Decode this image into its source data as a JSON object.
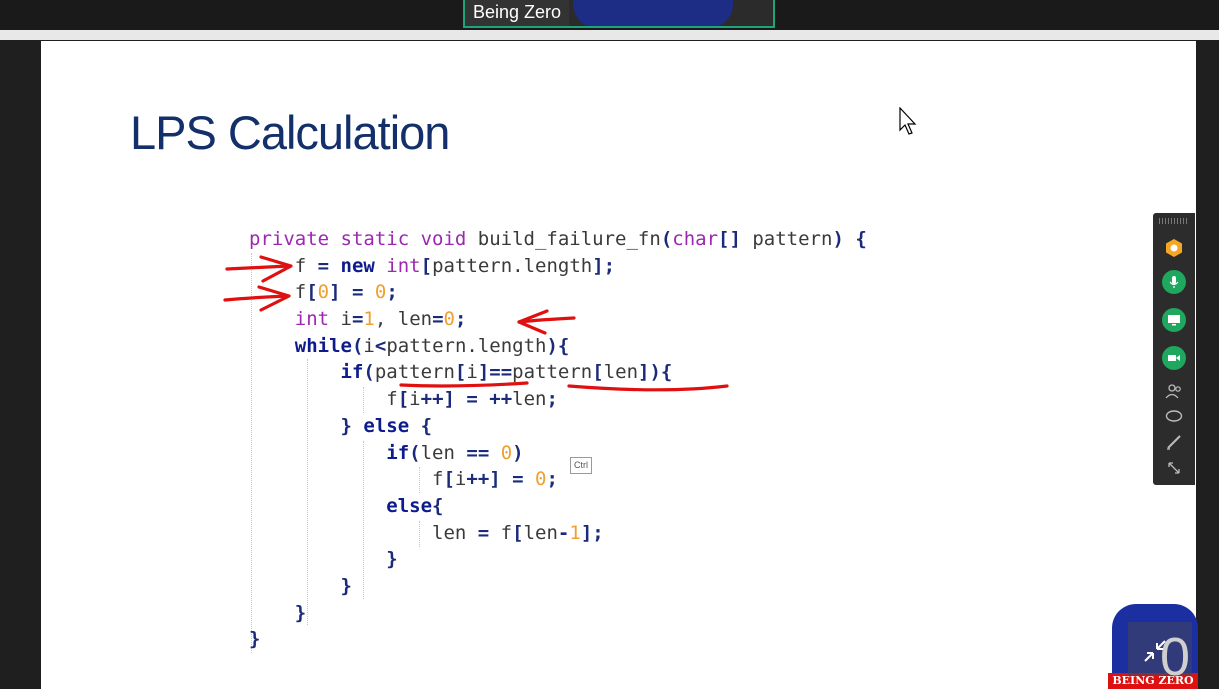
{
  "participant": {
    "name": "Being Zero"
  },
  "slide": {
    "title": "LPS Calculation"
  },
  "code_lines": [
    [
      {
        "t": "private static void",
        "c": "kw"
      },
      {
        "t": " build_failure_fn",
        "c": ""
      },
      {
        "t": "(",
        "c": "op"
      },
      {
        "t": "char",
        "c": "kw"
      },
      {
        "t": "[]",
        "c": "op"
      },
      {
        "t": " pattern",
        "c": ""
      },
      {
        "t": ")",
        "c": "op"
      },
      {
        "t": " {",
        "c": "op"
      }
    ],
    [
      {
        "t": "    f ",
        "c": ""
      },
      {
        "t": "=",
        "c": "op"
      },
      {
        "t": " new ",
        "c": "kwb"
      },
      {
        "t": "int",
        "c": "kw"
      },
      {
        "t": "[",
        "c": "op"
      },
      {
        "t": "pattern.length",
        "c": ""
      },
      {
        "t": "];",
        "c": "op"
      }
    ],
    [
      {
        "t": "    f",
        "c": ""
      },
      {
        "t": "[",
        "c": "op"
      },
      {
        "t": "0",
        "c": "num"
      },
      {
        "t": "]",
        "c": "op"
      },
      {
        "t": " = ",
        "c": "op"
      },
      {
        "t": "0",
        "c": "num"
      },
      {
        "t": ";",
        "c": "op"
      }
    ],
    [
      {
        "t": "    int",
        "c": "kw"
      },
      {
        "t": " i",
        "c": ""
      },
      {
        "t": "=",
        "c": "op"
      },
      {
        "t": "1",
        "c": "num"
      },
      {
        "t": ", len",
        "c": ""
      },
      {
        "t": "=",
        "c": "op"
      },
      {
        "t": "0",
        "c": "num"
      },
      {
        "t": ";",
        "c": "op"
      }
    ],
    [
      {
        "t": "    while",
        "c": "kwb"
      },
      {
        "t": "(",
        "c": "op"
      },
      {
        "t": "i",
        "c": ""
      },
      {
        "t": "<",
        "c": "op"
      },
      {
        "t": "pattern.length",
        "c": ""
      },
      {
        "t": "){",
        "c": "op"
      }
    ],
    [
      {
        "t": "        if",
        "c": "kwb"
      },
      {
        "t": "(",
        "c": "op"
      },
      {
        "t": "pattern",
        "c": ""
      },
      {
        "t": "[",
        "c": "op"
      },
      {
        "t": "i",
        "c": ""
      },
      {
        "t": "]==",
        "c": "op"
      },
      {
        "t": "pattern",
        "c": ""
      },
      {
        "t": "[",
        "c": "op"
      },
      {
        "t": "len",
        "c": ""
      },
      {
        "t": "]){",
        "c": "op"
      }
    ],
    [
      {
        "t": "            f",
        "c": ""
      },
      {
        "t": "[",
        "c": "op"
      },
      {
        "t": "i",
        "c": ""
      },
      {
        "t": "++]",
        "c": "op"
      },
      {
        "t": " = ",
        "c": "op"
      },
      {
        "t": "++",
        "c": "op"
      },
      {
        "t": "len",
        "c": ""
      },
      {
        "t": ";",
        "c": "op"
      }
    ],
    [
      {
        "t": "        }",
        "c": "op"
      },
      {
        "t": " else",
        "c": "kwb"
      },
      {
        "t": " {",
        "c": "op"
      }
    ],
    [
      {
        "t": "            if",
        "c": "kwb"
      },
      {
        "t": "(",
        "c": "op"
      },
      {
        "t": "len ",
        "c": ""
      },
      {
        "t": "==",
        "c": "op"
      },
      {
        "t": " ",
        "c": ""
      },
      {
        "t": "0",
        "c": "num"
      },
      {
        "t": ")",
        "c": "op"
      }
    ],
    [
      {
        "t": "                f",
        "c": ""
      },
      {
        "t": "[",
        "c": "op"
      },
      {
        "t": "i",
        "c": ""
      },
      {
        "t": "++]",
        "c": "op"
      },
      {
        "t": " = ",
        "c": "op"
      },
      {
        "t": "0",
        "c": "num"
      },
      {
        "t": ";",
        "c": "op"
      }
    ],
    [
      {
        "t": "            else",
        "c": "kwb"
      },
      {
        "t": "{",
        "c": "op"
      }
    ],
    [
      {
        "t": "                len ",
        "c": ""
      },
      {
        "t": "=",
        "c": "op"
      },
      {
        "t": " f",
        "c": ""
      },
      {
        "t": "[",
        "c": "op"
      },
      {
        "t": "len",
        "c": ""
      },
      {
        "t": "-",
        "c": "op"
      },
      {
        "t": "1",
        "c": "num"
      },
      {
        "t": "];",
        "c": "op"
      }
    ],
    [
      {
        "t": "            }",
        "c": "op"
      }
    ],
    [
      {
        "t": "        }",
        "c": "op"
      }
    ],
    [
      {
        "t": "    }",
        "c": "op"
      }
    ],
    [
      {
        "t": "}",
        "c": "op"
      }
    ]
  ],
  "tooltip": {
    "text": "Ctrl"
  },
  "toolbar": {
    "items": [
      {
        "name": "apps-icon"
      },
      {
        "name": "microphone-icon"
      },
      {
        "name": "share-screen-icon"
      },
      {
        "name": "camera-icon"
      },
      {
        "name": "participants-icon"
      },
      {
        "name": "chat-icon"
      },
      {
        "name": "pen-icon"
      },
      {
        "name": "expand-icon"
      }
    ]
  },
  "self_view": {
    "badge_digit": "0",
    "logo_text": "BEING ZERO"
  },
  "colors": {
    "accent_green": "#1fa760",
    "slide_title": "#14306a",
    "annotation_red": "#e01010"
  }
}
